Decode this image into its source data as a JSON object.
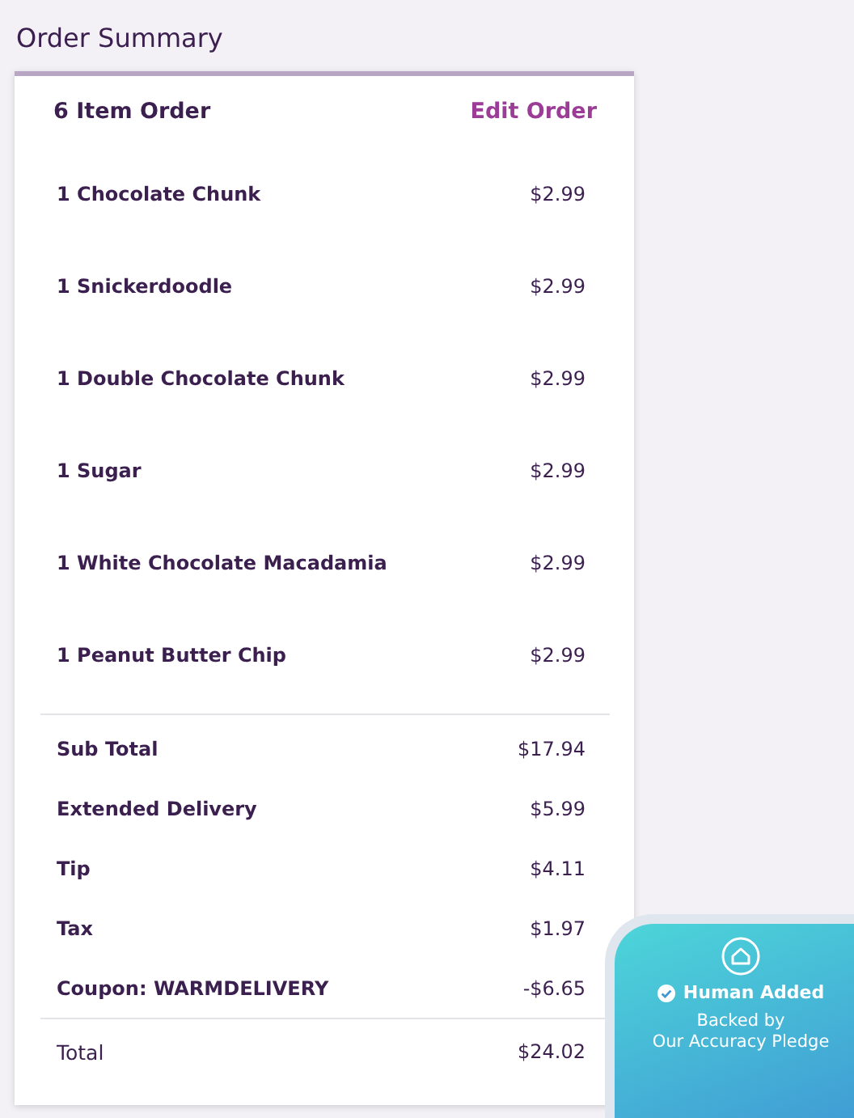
{
  "title": "Order Summary",
  "header": {
    "count_label": "6 Item Order",
    "edit_link": "Edit Order"
  },
  "items": [
    {
      "name": "1 Chocolate Chunk",
      "price": "$2.99"
    },
    {
      "name": "1 Snickerdoodle",
      "price": "$2.99"
    },
    {
      "name": "1 Double Chocolate Chunk",
      "price": "$2.99"
    },
    {
      "name": "1 Sugar",
      "price": "$2.99"
    },
    {
      "name": "1 White Chocolate Macadamia",
      "price": "$2.99"
    },
    {
      "name": "1 Peanut Butter Chip",
      "price": "$2.99"
    }
  ],
  "charges": [
    {
      "label": "Sub Total",
      "amount": "$17.94"
    },
    {
      "label": "Extended Delivery",
      "amount": "$5.99"
    },
    {
      "label": "Tip",
      "amount": "$4.11"
    },
    {
      "label": "Tax",
      "amount": "$1.97"
    },
    {
      "label": "Coupon: WARMDELIVERY",
      "amount": "-$6.65"
    }
  ],
  "total": {
    "label": "Total",
    "amount": "$24.02"
  },
  "badge": {
    "title": "Human Added",
    "subtitle_1": "Backed by",
    "subtitle_2": "Our Accuracy Pledge"
  }
}
